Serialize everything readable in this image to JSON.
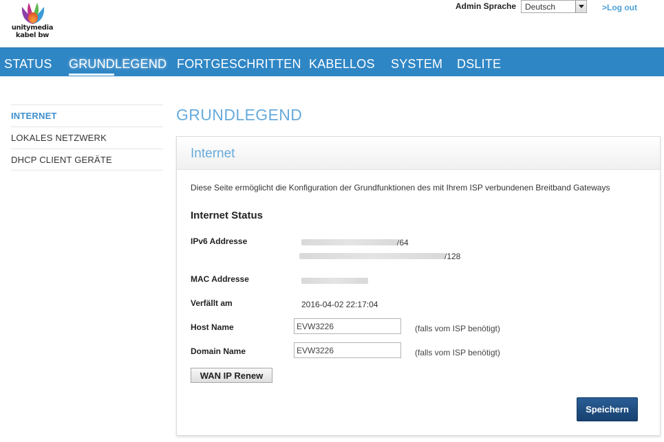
{
  "header": {
    "logo": {
      "line1": "unitymedia",
      "line2": "kabel bw"
    },
    "language": {
      "label": "Admin Sprache",
      "selected": "Deutsch"
    },
    "logout": ">Log out"
  },
  "nav": {
    "items": [
      "STATUS",
      "GRUNDLEGEND",
      "FORTGESCHRITTEN",
      "KABELLOS",
      "SYSTEM",
      "DSLITE"
    ],
    "active": "GRUNDLEGEND"
  },
  "sidebar": {
    "items": [
      "INTERNET",
      "LOKALES NETZWERK",
      "DHCP CLIENT GERÄTE"
    ],
    "active": "INTERNET"
  },
  "main": {
    "page_title": "GRUNDLEGEND",
    "panel": {
      "title": "Internet",
      "description": "Diese Seite ermöglicht die Konfiguration der Grundfunktionen des mit Ihrem ISP verbundenen Breitband Gateways",
      "section_title": "Internet Status",
      "ipv6": {
        "label": "IPv6 Addresse",
        "suffix1": "/64",
        "suffix2": "/128"
      },
      "mac": {
        "label": "MAC Addresse"
      },
      "expires": {
        "label": "Verfällt am",
        "value": "2016-04-02 22:17:04"
      },
      "host_name": {
        "label": "Host Name",
        "value": "EVW3226",
        "hint": "(falls vom ISP benötigt)"
      },
      "domain_name": {
        "label": "Domain Name",
        "value": "EVW3226",
        "hint": "(falls vom ISP benötigt)"
      },
      "renew_button": "WAN IP Renew",
      "save_button": "Speichern"
    }
  },
  "colors": {
    "nav_bg": "#2f86c5",
    "accent_blue": "#67abdc",
    "link_blue": "#4a9fd6",
    "save_button": "#1f4e82"
  }
}
